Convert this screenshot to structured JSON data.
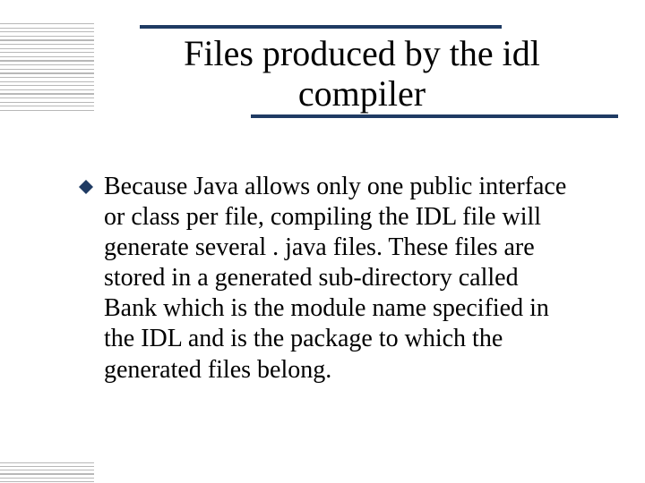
{
  "slide": {
    "title": "Files produced by the idl compiler",
    "bullets": [
      "Because Java allows only one public interface or class per file, compiling the IDL file will generate several . java files. These files are stored in a generated sub-directory called Bank which is the module name specified in the IDL and is the package to which the generated files belong."
    ]
  },
  "theme": {
    "accent": "#1f3b63",
    "stripe": "#b8b8b8"
  }
}
